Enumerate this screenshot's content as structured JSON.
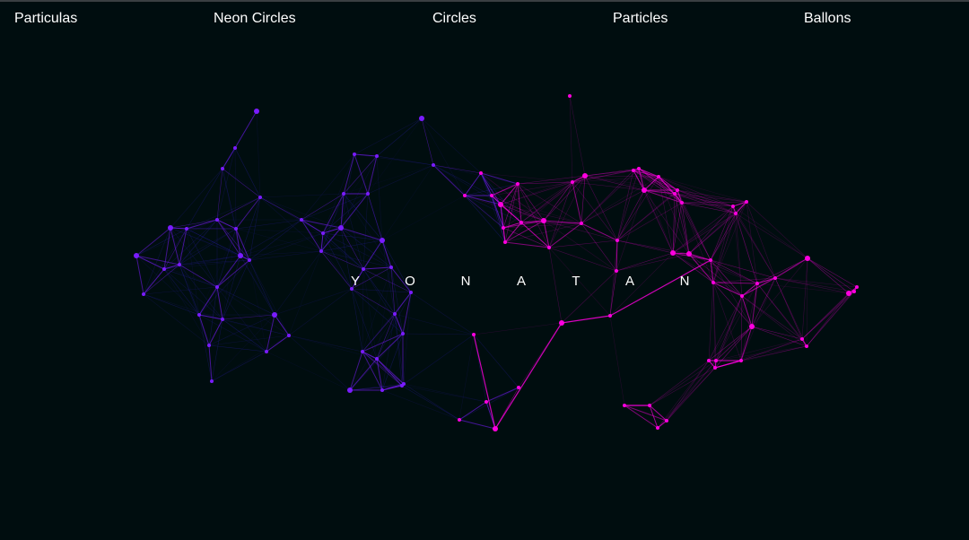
{
  "nav": {
    "items": [
      {
        "label": "Particulas"
      },
      {
        "label": "Neon Circles"
      },
      {
        "label": "Circles"
      },
      {
        "label": "Particles"
      },
      {
        "label": "Ballons"
      }
    ]
  },
  "title": {
    "letters": [
      "Y",
      "O",
      "N",
      "A",
      "T",
      "A",
      "N"
    ]
  },
  "colors": {
    "background": "#000d0f",
    "particle_primary": "#ff00e0",
    "particle_secondary": "#7a1cff",
    "line_dim": "#2a1fb0",
    "text": "#ffffff"
  }
}
